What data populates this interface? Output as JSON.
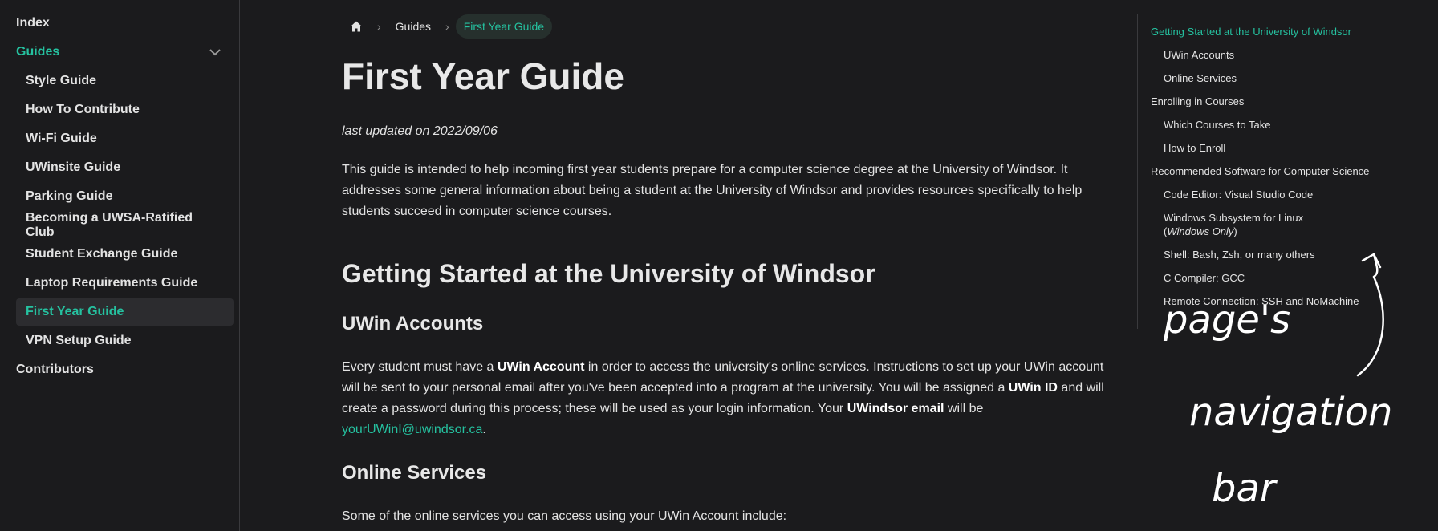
{
  "sidebar": {
    "items": [
      {
        "label": "Index"
      },
      {
        "label": "Guides"
      },
      {
        "label": "Style Guide"
      },
      {
        "label": "How To Contribute"
      },
      {
        "label": "Wi-Fi Guide"
      },
      {
        "label": "UWinsite Guide"
      },
      {
        "label": "Parking Guide"
      },
      {
        "label": "Becoming a UWSA-Ratified Club"
      },
      {
        "label": "Student Exchange Guide"
      },
      {
        "label": "Laptop Requirements Guide"
      },
      {
        "label": "First Year Guide"
      },
      {
        "label": "VPN Setup Guide"
      },
      {
        "label": "Contributors"
      }
    ]
  },
  "breadcrumbs": {
    "guides": "Guides",
    "current": "First Year Guide"
  },
  "article": {
    "title": "First Year Guide",
    "updated": "last updated on 2022/09/06",
    "intro": "This guide is intended to help incoming first year students prepare for a computer science degree at the University of Windsor. It addresses some general information about being a student at the University of Windsor and provides resources specifically to help students succeed in computer science courses.",
    "h2_getting_started": "Getting Started at the University of Windsor",
    "h3_accounts": "UWin Accounts",
    "accounts_p": {
      "t1": "Every student must have a ",
      "b1": "UWin Account",
      "t2": " in order to access the university's online services. Instructions to set up your UWin account will be sent to your personal email after you've been accepted into a program at the university. You will be assigned a ",
      "b2": "UWin ID",
      "t3": " and will create a password during this process; these will be used as your login information. Your ",
      "b3": "UWindsor email",
      "t4": " will be ",
      "link": "yourUWinI@uwindsor.ca",
      "t5": "."
    },
    "h3_online": "Online Services",
    "online_p": "Some of the online services you can access using your UWin Account include:"
  },
  "toc": {
    "items": [
      {
        "label": "Getting Started at the University of Windsor"
      },
      {
        "label": "UWin Accounts"
      },
      {
        "label": "Online Services"
      },
      {
        "label": "Enrolling in Courses"
      },
      {
        "label": "Which Courses to Take"
      },
      {
        "label": "How to Enroll"
      },
      {
        "label": "Recommended Software for Computer Science"
      },
      {
        "label": "Code Editor: Visual Studio Code"
      },
      {
        "label": "Windows Subsystem for Linux ("
      },
      {
        "label": "Windows Only"
      },
      {
        "label": ")"
      },
      {
        "label": "Shell: Bash, Zsh, or many others"
      },
      {
        "label": "C Compiler: GCC"
      },
      {
        "label": "Remote Connection: SSH and NoMachine"
      }
    ]
  },
  "annotation": {
    "line1": "page's",
    "line2": "navigation",
    "line3": "bar"
  },
  "colors": {
    "background": "#1b1b1d",
    "accent": "#25c2a0",
    "text": "#e3e3e3"
  },
  "icons": {
    "home": "home-icon",
    "chevron": "chevron-down-icon",
    "separator": "chevron-right-icon"
  }
}
